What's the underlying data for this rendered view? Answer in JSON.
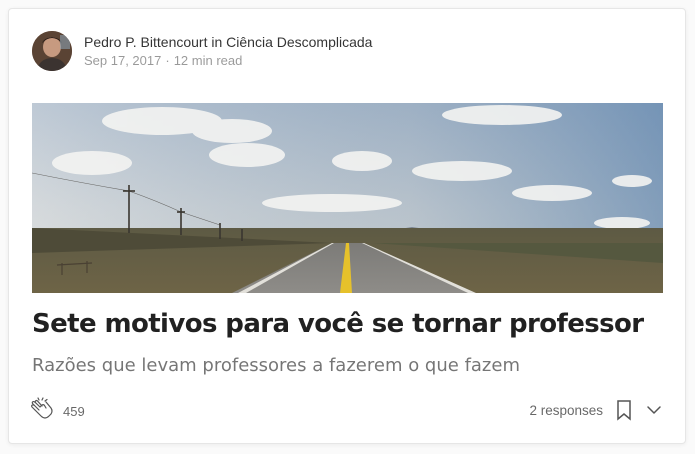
{
  "post": {
    "author": "Pedro P. Bittencourt",
    "in_word": "in",
    "publication": "Ciência Descomplicada",
    "date": "Sep 17, 2017",
    "separator": "·",
    "read_time": "12 min read",
    "title": "Sete motivos para você se tornar professor",
    "subtitle": "Razões que levam professores a fazerem o que fazem"
  },
  "footer": {
    "clap_count": "459",
    "responses_label": "2 responses"
  },
  "icons": {
    "clap": "clap-icon",
    "bookmark": "bookmark-icon",
    "more": "chevron-down-icon"
  },
  "colors": {
    "sky": "#8fa9c6",
    "road_line": "#e6c12b",
    "text_primary": "#000000de",
    "text_secondary": "#0000008a"
  }
}
